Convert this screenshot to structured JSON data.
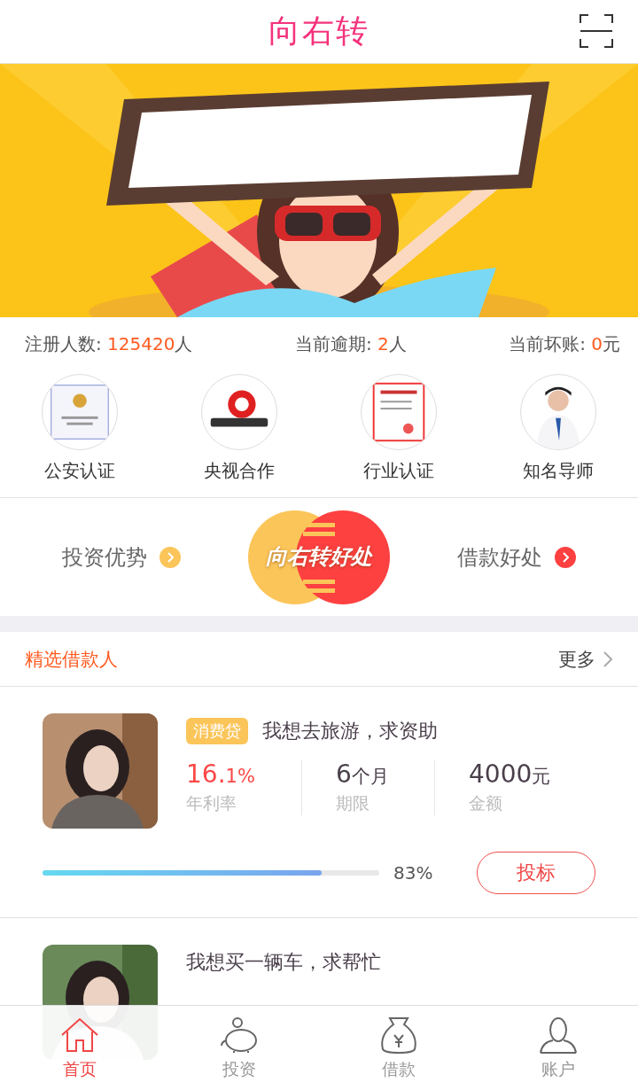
{
  "header": {
    "title": "向右转"
  },
  "stats": [
    {
      "label": "注册人数: ",
      "value": "125420",
      "unit": "人"
    },
    {
      "label": "当前逾期: ",
      "value": "2",
      "unit": "人"
    },
    {
      "label": "当前坏账: ",
      "value": "0",
      "unit": "元"
    }
  ],
  "credentials": [
    {
      "label": "公安认证"
    },
    {
      "label": "央视合作"
    },
    {
      "label": "行业认证"
    },
    {
      "label": "知名导师"
    }
  ],
  "promo": {
    "left": "投资优势",
    "logo": "向右转好处",
    "right": "借款好处"
  },
  "section": {
    "title": "精选借款人",
    "more": "更多"
  },
  "loans": [
    {
      "tag": "消费贷",
      "title": "我想去旅游，求资助",
      "rate_main": "16.",
      "rate_rest": "1%",
      "rate_label": "年利率",
      "term": "6",
      "term_unit": "个月",
      "term_label": "期限",
      "amount": "4000",
      "amount_unit": "元",
      "amount_label": "金额",
      "level": 0.83,
      "percent": "83%",
      "button": "投标"
    },
    {
      "title": "我想买一辆车，求帮忙"
    }
  ],
  "tabs": [
    {
      "label": "首页",
      "selected": true
    },
    {
      "label": "投资",
      "selected": false
    },
    {
      "label": "借款",
      "selected": false
    },
    {
      "label": "账户",
      "selected": false
    }
  ]
}
